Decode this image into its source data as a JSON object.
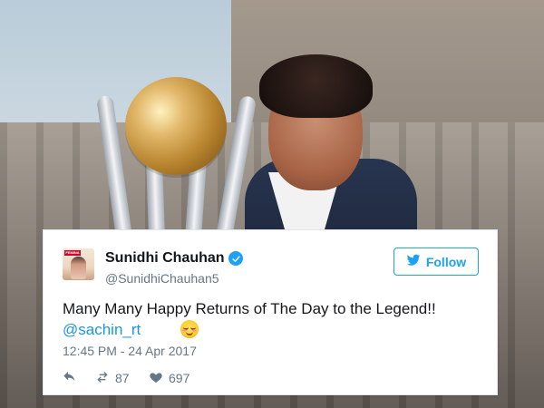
{
  "tweet": {
    "display_name": "Sunidhi Chauhan",
    "handle": "@SunidhiChauhan5",
    "follow_label": "Follow",
    "text": "Many Many Happy Returns of The Day to the Legend!!",
    "mention": "@sachin_rt",
    "timestamp": "12:45 PM - 24 Apr 2017",
    "retweets": "87",
    "likes": "697",
    "avatar_text": "FEMINA"
  },
  "icons": {
    "verified": "verified-icon",
    "follow_bird": "twitter-bird-icon",
    "reply": "reply-icon",
    "retweet": "retweet-icon",
    "like": "heart-icon",
    "emoji": "smiling-face-emoji"
  },
  "colors": {
    "twitter_blue": "#1da1f2",
    "mention_blue": "#1b95e0",
    "text_dark": "#14171a",
    "text_muted": "#657786",
    "card_border": "#e1e8ed"
  }
}
